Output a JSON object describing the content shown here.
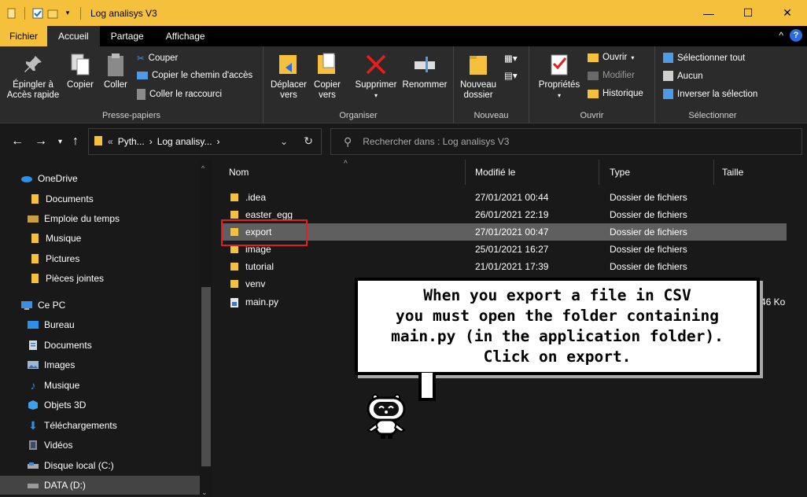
{
  "window": {
    "title": "Log analisys V3",
    "minimize": "—",
    "maximize": "☐",
    "close": "✕"
  },
  "menu": {
    "tabs": [
      "Fichier",
      "Accueil",
      "Partage",
      "Affichage"
    ]
  },
  "ribbon": {
    "pin": "Épingler à Accès rapide",
    "copy": "Copier",
    "paste": "Coller",
    "cut": "Couper",
    "copy_path": "Copier le chemin d'accès",
    "paste_shortcut": "Coller le raccourci",
    "group_clipboard": "Presse-papiers",
    "move_to": "Déplacer vers",
    "copy_to": "Copier vers",
    "delete": "Supprimer",
    "rename": "Renommer",
    "group_organize": "Organiser",
    "new_folder": "Nouveau dossier",
    "group_new": "Nouveau",
    "properties": "Propriétés",
    "open": "Ouvrir",
    "edit": "Modifier",
    "history": "Historique",
    "group_open": "Ouvrir",
    "select_all": "Sélectionner tout",
    "select_none": "Aucun",
    "invert_selection": "Inverser la sélection",
    "group_select": "Sélectionner"
  },
  "address": {
    "prefix": "«",
    "crumb1": "Pyth...",
    "sep": "›",
    "crumb2": "Log analisy...",
    "sep2": "›"
  },
  "search": {
    "placeholder": "Rechercher dans : Log analisys V3"
  },
  "sidebar": {
    "items": [
      "OneDrive",
      "Documents",
      "Emploie du temps",
      "Musique",
      "Pictures",
      "Pièces jointes",
      "Ce PC",
      "Bureau",
      "Documents",
      "Images",
      "Musique",
      "Objets 3D",
      "Téléchargements",
      "Vidéos",
      "Disque local (C:)",
      "DATA (D:)"
    ]
  },
  "columns": {
    "name": "Nom",
    "modified": "Modifié le",
    "type": "Type",
    "size": "Taille"
  },
  "files": [
    {
      "name": ".idea",
      "modified": "27/01/2021 00:44",
      "type": "Dossier de fichiers",
      "size": ""
    },
    {
      "name": "easter_egg",
      "modified": "26/01/2021 22:19",
      "type": "Dossier de fichiers",
      "size": ""
    },
    {
      "name": "export",
      "modified": "27/01/2021 00:47",
      "type": "Dossier de fichiers",
      "size": ""
    },
    {
      "name": "image",
      "modified": "25/01/2021 16:27",
      "type": "Dossier de fichiers",
      "size": ""
    },
    {
      "name": "tutorial",
      "modified": "21/01/2021 17:39",
      "type": "Dossier de fichiers",
      "size": ""
    },
    {
      "name": "venv",
      "modified": "",
      "type": "",
      "size": ""
    },
    {
      "name": "main.py",
      "modified": "",
      "type": "",
      "size": "46 Ko"
    }
  ],
  "bubble": {
    "line1": "When you export a file in CSV",
    "line2": "you must open the folder containing",
    "line3": "main.py (in the application folder).",
    "line4": "Click on export."
  },
  "colors": {
    "accent": "#f5c13d",
    "selection": "#5f5f5f",
    "highlight": "#e02020"
  }
}
